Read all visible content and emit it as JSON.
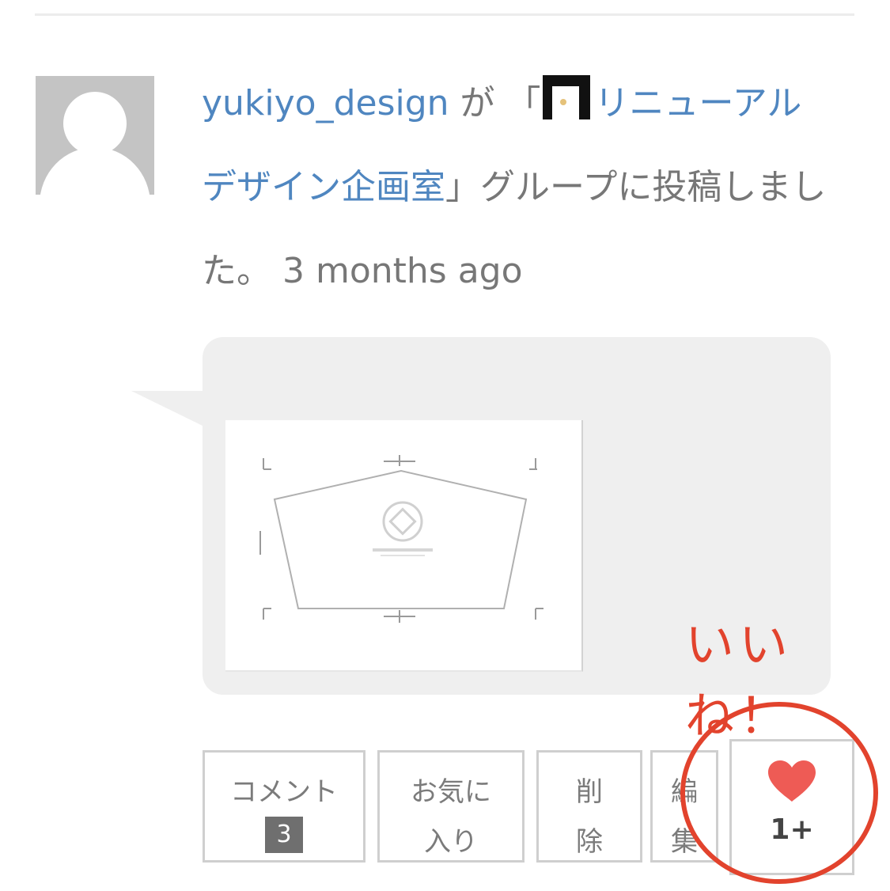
{
  "activity": {
    "username": "yukiyo_design",
    "particle_ga": " が ",
    "open_quote": "「",
    "group_name": "リニューアルデザイン企画室",
    "close_quote": "」",
    "text_after": "グループに投稿しました。",
    "time_ago": "3 months ago"
  },
  "actions": {
    "comment_label": "コメント",
    "comment_count": "3",
    "favorite_label_1": "お気に",
    "favorite_label_2": "入り",
    "delete_label_1": "削",
    "delete_label_2": "除",
    "edit_label_1": "編",
    "edit_label_2": "集",
    "like_count": "1+"
  },
  "annotation": {
    "text": "いいね！",
    "color": "#e2432d"
  },
  "colors": {
    "link": "#4f86c0",
    "heart": "#ee5b55",
    "bubble": "#efefef"
  }
}
